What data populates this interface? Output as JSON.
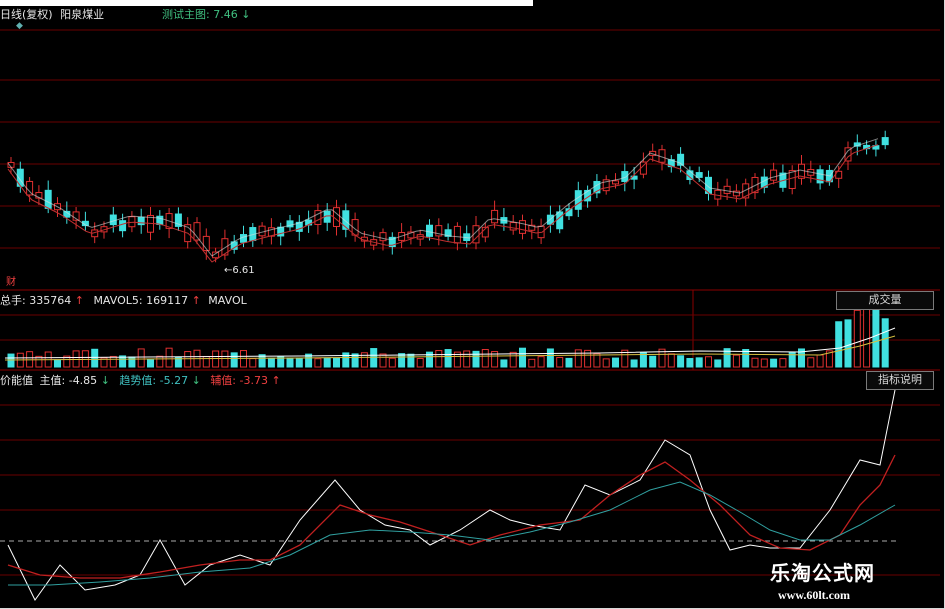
{
  "header": {
    "period": "日线(复权)",
    "stock_name": "阳泉煤业",
    "main_indicator_label": "测试主图:",
    "main_indicator_value": "7.46",
    "main_indicator_arrow": "↓"
  },
  "price_panel": {
    "low_marker": "←6.61",
    "fin_badge": "财"
  },
  "volume_panel": {
    "total_label": "总手:",
    "total_value": "335764",
    "total_arrow": "↑",
    "mavol5_label": "MAVOL5:",
    "mavol5_value": "169117",
    "mavol5_arrow": "↑",
    "mavol_cut": "MAVOL",
    "button": "成交量"
  },
  "indicator_panel": {
    "name": "价能值",
    "main_label": "主值:",
    "main_value": "-4.85",
    "main_arrow": "↓",
    "trend_label": "趋势值:",
    "trend_value": "-5.27",
    "trend_arrow": "↓",
    "aux_label": "辅值:",
    "aux_value": "-3.73",
    "aux_arrow": "↑",
    "button": "指标说明"
  },
  "watermark": {
    "title": "乐淘公式网",
    "url": "www.60lt.com"
  },
  "colors": {
    "up": "#e03030",
    "down": "#40e0e0",
    "white_line": "#ffffff",
    "red_line": "#c02020",
    "teal_line": "#30a0a0",
    "grid": "#6a0000"
  },
  "icons": {
    "diamond": "◆"
  }
}
